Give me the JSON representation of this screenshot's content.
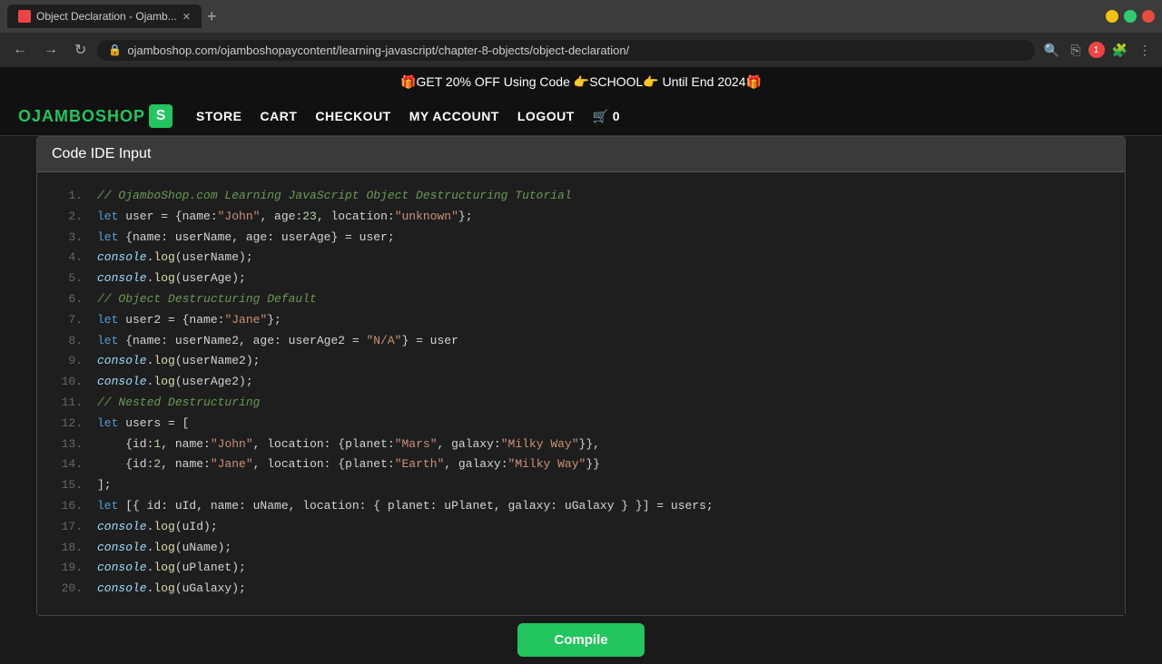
{
  "browser": {
    "tab_title": "Object Declaration - Ojamb...",
    "url": "ojamboshop.com/ojamboshopaycontent/learning-javascript/chapter-8-objects/object-declaration/",
    "new_tab_label": "+",
    "back_tooltip": "Back",
    "forward_tooltip": "Forward",
    "refresh_tooltip": "Refresh"
  },
  "promo": {
    "text": "🎁GET 20% OFF Using Code 👉SCHOOL👉 Until End 2024🎁"
  },
  "nav": {
    "logo_text": "OJAMBOSHOP",
    "logo_s": "S",
    "store": "STORE",
    "cart": "CART",
    "checkout": "CHECKOUT",
    "my_account": "MY ACCOUNT",
    "logout": "LOGOUT",
    "cart_icon": "🛒",
    "cart_count": "0"
  },
  "ide": {
    "title": "Code IDE Input",
    "compile_label": "Compile"
  },
  "code_lines": [
    {
      "num": "1",
      "content": "// OjamboShop.com Learning JavaScript Object Destructuring Tutorial"
    },
    {
      "num": "2",
      "content": "let user = {name:\"John\", age:23, location:\"unknown\"};"
    },
    {
      "num": "3",
      "content": "let {name: userName, age: userAge} = user;"
    },
    {
      "num": "4",
      "content": "console.log(userName);"
    },
    {
      "num": "5",
      "content": "console.log(userAge);"
    },
    {
      "num": "6",
      "content": "// Object Destructuring Default"
    },
    {
      "num": "7",
      "content": "let user2 = {name:\"Jane\"};"
    },
    {
      "num": "8",
      "content": "let {name: userName2, age: userAge2 = \"N/A\"} = user"
    },
    {
      "num": "9",
      "content": "console.log(userName2);"
    },
    {
      "num": "10",
      "content": "console.log(userAge2);"
    },
    {
      "num": "11",
      "content": "// Nested Destructuring"
    },
    {
      "num": "12",
      "content": "let users = ["
    },
    {
      "num": "13",
      "content": "    {id:1, name:\"John\", location: {planet:\"Mars\", galaxy:\"Milky Way\"}},"
    },
    {
      "num": "14",
      "content": "    {id:2, name:\"Jane\", location: {planet:\"Earth\", galaxy:\"Milky Way\"}}"
    },
    {
      "num": "15",
      "content": "];"
    },
    {
      "num": "16",
      "content": "let [{ id: uId, name: uName, location: { planet: uPlanet, galaxy: uGalaxy } }] = users;"
    },
    {
      "num": "17",
      "content": "console.log(uId);"
    },
    {
      "num": "18",
      "content": "console.log(uName);"
    },
    {
      "num": "19",
      "content": "console.log(uPlanet);"
    },
    {
      "num": "20",
      "content": "console.log(uGalaxy);"
    }
  ]
}
